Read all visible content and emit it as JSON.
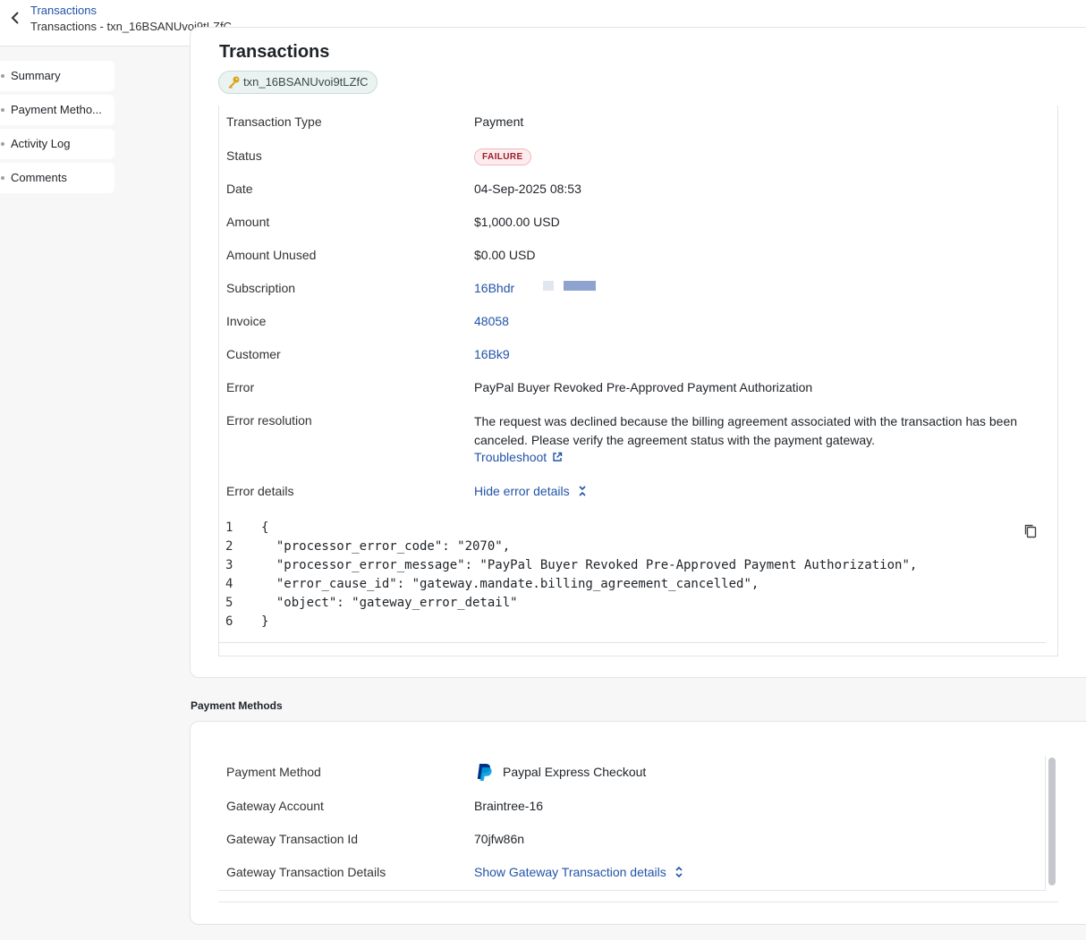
{
  "header": {
    "breadcrumb": "Transactions",
    "subtitle": "Transactions - txn_16BSANUvoi9tLZfC"
  },
  "nav": {
    "items": [
      "Summary",
      "Payment Metho...",
      "Activity Log",
      "Comments"
    ]
  },
  "transaction": {
    "title": "Transactions",
    "id_chip": "txn_16BSANUvoi9tLZfC",
    "fields": {
      "type_label": "Transaction Type",
      "type_value": "Payment",
      "status_label": "Status",
      "status_value": "FAILURE",
      "date_label": "Date",
      "date_value": "04-Sep-2025 08:53",
      "amount_label": "Amount",
      "amount_value": "$1,000.00 USD",
      "unused_label": "Amount Unused",
      "unused_value": "$0.00 USD",
      "subscription_label": "Subscription",
      "subscription_value": "16Bhdr",
      "invoice_label": "Invoice",
      "invoice_value": "48058",
      "customer_label": "Customer",
      "customer_value": "16Bk9",
      "error_label": "Error",
      "error_value": "PayPal Buyer Revoked Pre-Approved Payment Authorization",
      "resolution_label": "Error resolution",
      "resolution_value": "The request was declined because the billing agreement associated with the transaction has been canceled. Please verify the agreement status with the payment gateway.",
      "troubleshoot_label": "Troubleshoot",
      "details_label": "Error details",
      "details_toggle": "Hide error details"
    },
    "code_lines": [
      {
        "n": "1",
        "t": "{"
      },
      {
        "n": "2",
        "t": "  \"processor_error_code\": \"2070\","
      },
      {
        "n": "3",
        "t": "  \"processor_error_message\": \"PayPal Buyer Revoked Pre-Approved Payment Authorization\","
      },
      {
        "n": "4",
        "t": "  \"error_cause_id\": \"gateway.mandate.billing_agreement_cancelled\","
      },
      {
        "n": "5",
        "t": "  \"object\": \"gateway_error_detail\""
      },
      {
        "n": "6",
        "t": "}"
      }
    ]
  },
  "payment_methods": {
    "heading": "Payment Methods",
    "method_label": "Payment Method",
    "method_value": "Paypal Express Checkout",
    "account_label": "Gateway Account",
    "account_value": "Braintree-16",
    "txid_label": "Gateway Transaction Id",
    "txid_value": "70jfw86n",
    "details_label": "Gateway Transaction Details",
    "details_toggle": "Show Gateway Transaction details"
  },
  "colors": {
    "link": "#2253a8",
    "failure_badge_bg": "#fdecee",
    "failure_badge_text": "#9b1c2a",
    "paypal_dark": "#003087",
    "paypal_light": "#009cde"
  },
  "icons": {
    "back": "chevron-left-icon",
    "key": "key-icon",
    "external": "external-link-icon",
    "collapse": "chevron-collapse-icon",
    "expand": "chevron-expand-icon",
    "copy": "copy-icon",
    "paypal": "paypal-logo-icon"
  }
}
